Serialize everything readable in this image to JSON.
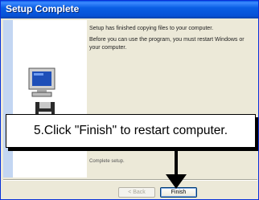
{
  "window": {
    "title": "Setup Complete"
  },
  "content": {
    "line1": "Setup has finished copying files to your computer.",
    "line2": "Before you can use the program, you must restart Windows or your computer.",
    "hidden_text": "Complete setup."
  },
  "buttons": {
    "back": "< Back",
    "finish": "Finish"
  },
  "callout": {
    "text": "5.Click \"Finish\" to restart computer."
  },
  "colors": {
    "titlebar": "#0a5ee4",
    "window_bg": "#ece9d8",
    "callout_border": "#000000"
  },
  "icons": [
    "computer-icon",
    "floppy-disk-icon",
    "arrow-down-icon"
  ]
}
